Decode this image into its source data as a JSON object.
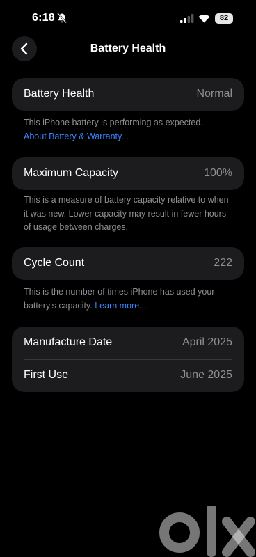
{
  "status_bar": {
    "time": "6:18",
    "battery_level": "82"
  },
  "nav": {
    "title": "Battery Health"
  },
  "health": {
    "label": "Battery Health",
    "value": "Normal",
    "footnote": "This iPhone battery is performing as expected.",
    "link": "About Battery & Warranty..."
  },
  "capacity": {
    "label": "Maximum Capacity",
    "value": "100%",
    "footnote": "This is a measure of battery capacity relative to when it was new. Lower capacity may result in fewer hours of usage between charges."
  },
  "cycles": {
    "label": "Cycle Count",
    "value": "222",
    "footnote": "This is the number of times iPhone has used your battery's capacity.",
    "link": "Learn more..."
  },
  "dates": {
    "manufacture_label": "Manufacture Date",
    "manufacture_value": "April 2025",
    "first_use_label": "First Use",
    "first_use_value": "June 2025"
  },
  "watermark": {
    "text": "olx"
  },
  "colors": {
    "accent": "#3a84ff",
    "card": "#1c1c1e",
    "secondary_text": "#8e8e93"
  }
}
